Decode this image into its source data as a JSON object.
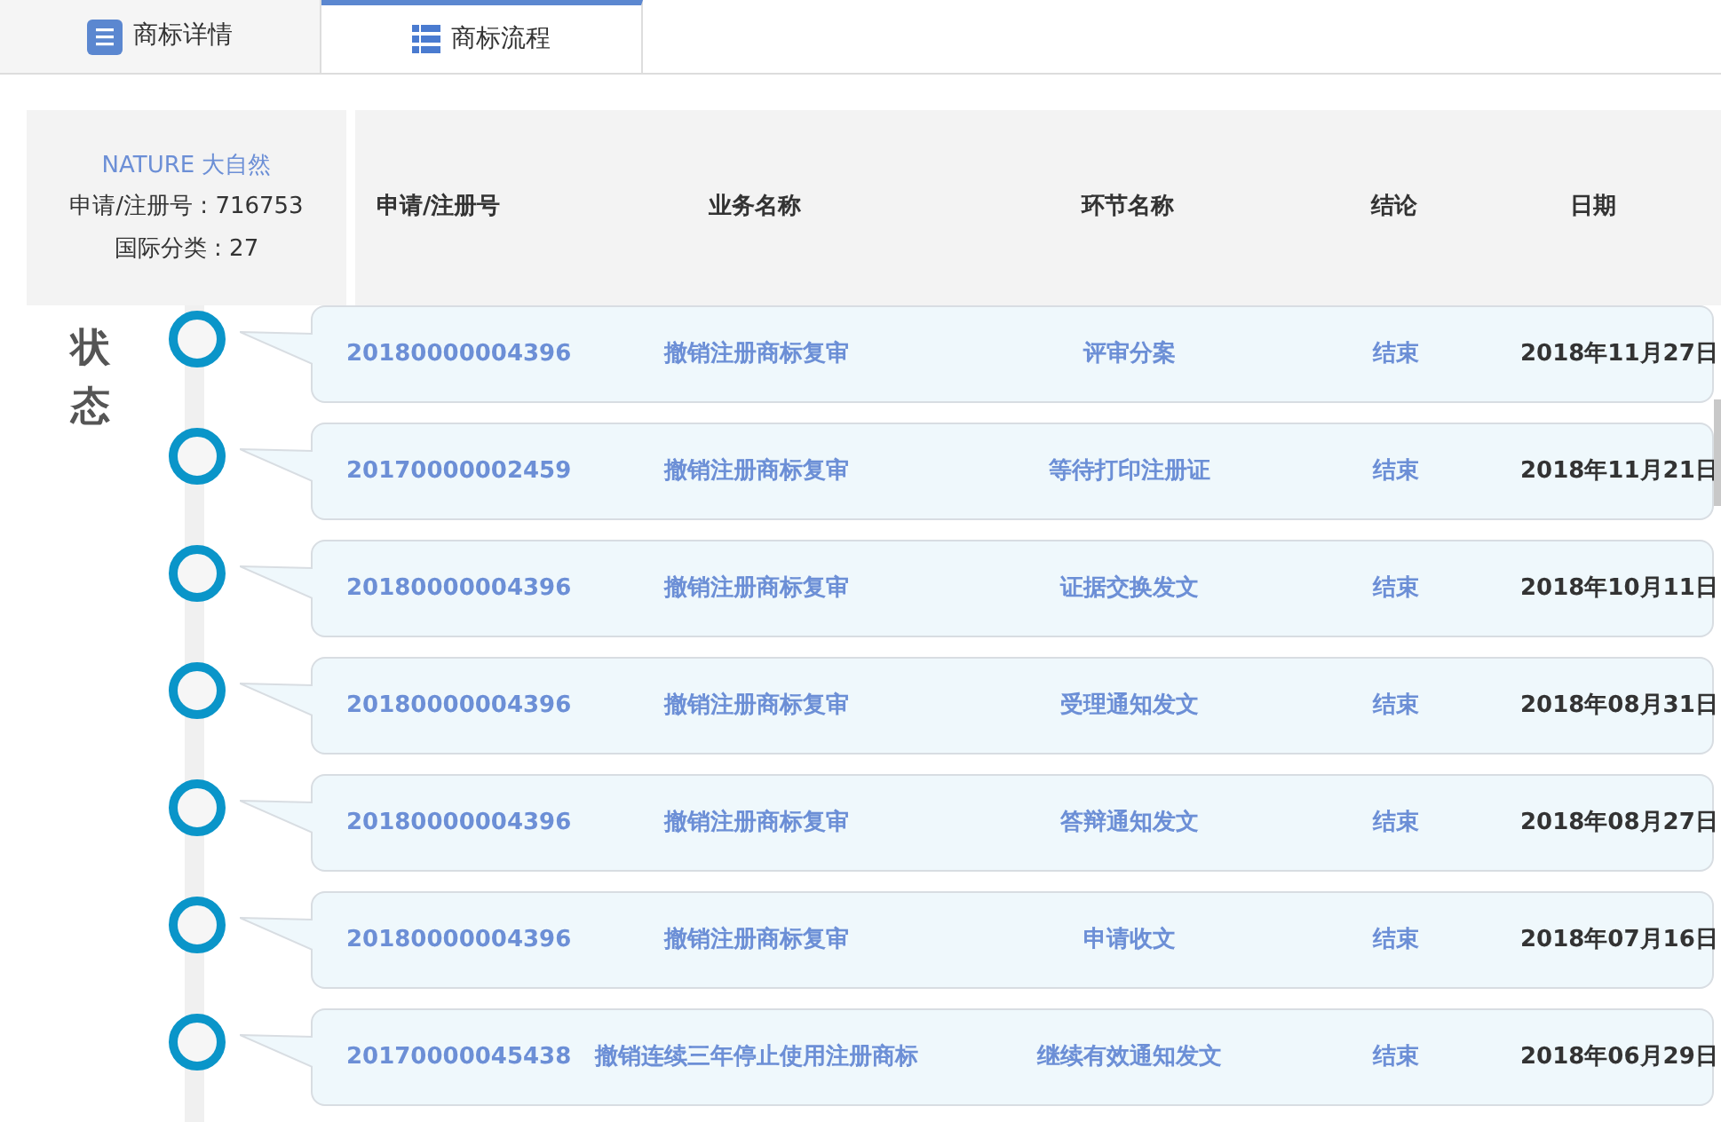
{
  "tabs": [
    {
      "label": "商标详情",
      "kind": "detail",
      "selected": false
    },
    {
      "label": "商标流程",
      "kind": "flow",
      "selected": true
    }
  ],
  "mark": {
    "name": "NATURE 大自然",
    "registration": "申请/注册号 : 716753",
    "class": "国际分类 : 27"
  },
  "status_label": "状态",
  "columns": [
    "申请/注册号",
    "业务名称",
    "环节名称",
    "结论",
    "日期"
  ],
  "rows": [
    {
      "number": "20180000004396",
      "business": "撤销注册商标复审",
      "step": "评审分案",
      "conclusion": "结束",
      "date": "2018年11月27日"
    },
    {
      "number": "20170000002459",
      "business": "撤销注册商标复审",
      "step": "等待打印注册证",
      "conclusion": "结束",
      "date": "2018年11月21日"
    },
    {
      "number": "20180000004396",
      "business": "撤销注册商标复审",
      "step": "证据交换发文",
      "conclusion": "结束",
      "date": "2018年10月11日"
    },
    {
      "number": "20180000004396",
      "business": "撤销注册商标复审",
      "step": "受理通知发文",
      "conclusion": "结束",
      "date": "2018年08月31日"
    },
    {
      "number": "20180000004396",
      "business": "撤销注册商标复审",
      "step": "答辩通知发文",
      "conclusion": "结束",
      "date": "2018年08月27日"
    },
    {
      "number": "20180000004396",
      "business": "撤销注册商标复审",
      "step": "申请收文",
      "conclusion": "结束",
      "date": "2018年07月16日"
    },
    {
      "number": "20170000045438",
      "business": "撤销连续三年停止使用注册商标",
      "step": "继续有效通知发文",
      "conclusion": "结束",
      "date": "2018年06月29日"
    }
  ]
}
